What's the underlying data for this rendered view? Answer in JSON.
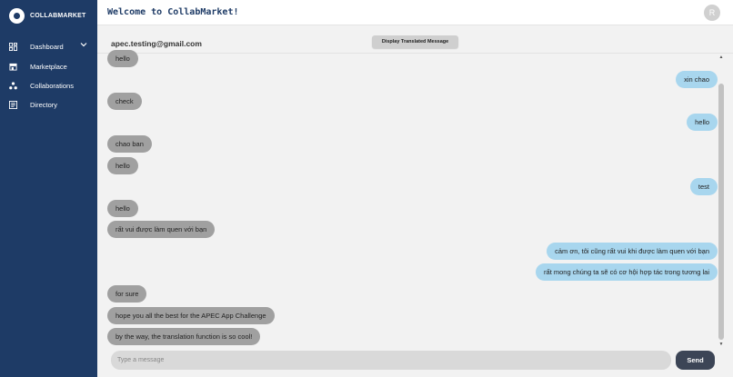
{
  "brand": {
    "name": "COLLABMARKET"
  },
  "sidebar": {
    "items": [
      {
        "label": "Dashboard",
        "icon": "grid-icon",
        "has_submenu": true
      },
      {
        "label": "Marketplace",
        "icon": "store-icon"
      },
      {
        "label": "Collaborations",
        "icon": "network-icon"
      },
      {
        "label": "Directory",
        "icon": "list-icon"
      }
    ]
  },
  "header": {
    "title": "Welcome to CollabMarket!",
    "avatar_initial": "R"
  },
  "chat": {
    "user_email": "apec.testing@gmail.com",
    "translate_label": "Display Translated Message",
    "messages": [
      {
        "text": "hello",
        "dir": "recv"
      },
      {
        "text": "xin chao",
        "dir": "sent"
      },
      {
        "text": "check",
        "dir": "recv"
      },
      {
        "text": "hello",
        "dir": "sent"
      },
      {
        "text": "chao ban",
        "dir": "recv"
      },
      {
        "text": "hello",
        "dir": "recv"
      },
      {
        "text": "test",
        "dir": "sent"
      },
      {
        "text": "hello",
        "dir": "recv"
      },
      {
        "text": "rất vui được làm quen với bạn",
        "dir": "recv"
      },
      {
        "text": "cảm ơn, tôi cũng rất vui khi được làm quen với bạn",
        "dir": "sent"
      },
      {
        "text": "rất mong chúng ta sẽ có cơ hội hợp tác trong tương lai",
        "dir": "sent"
      },
      {
        "text": "for sure",
        "dir": "recv"
      },
      {
        "text": "hope you all the best for the APEC App Challenge",
        "dir": "recv"
      },
      {
        "text": "by the way, the translation function is so cool!",
        "dir": "recv"
      }
    ],
    "input_placeholder": "Type a message",
    "send_label": "Send"
  },
  "colors": {
    "sidebar_bg": "#1e3b66",
    "received_bubble": "#a0a0a0",
    "sent_bubble": "#a8d6ee",
    "send_button": "#3c4556"
  }
}
